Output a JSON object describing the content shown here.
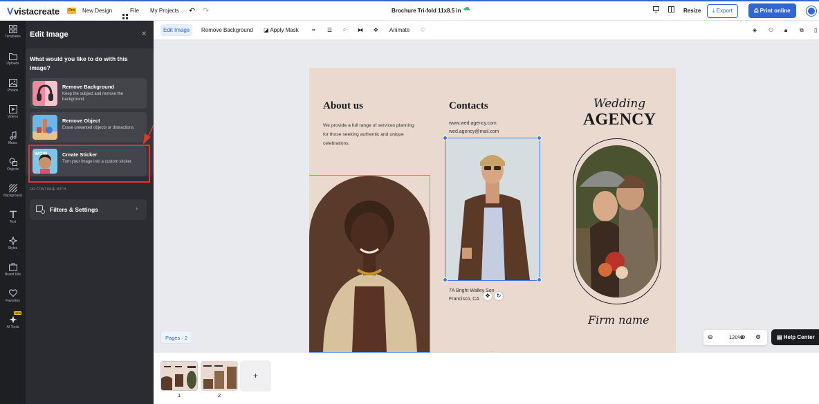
{
  "header": {
    "logo": "vistacreate",
    "pro_badge": "Pro",
    "new_design": "New Design",
    "file": "File",
    "my_projects": "My Projects",
    "doc_title": "Brochure Tri-fold 11x8.5 in",
    "resize": "Resize",
    "export": "Export",
    "print_online": "Print online"
  },
  "rail": {
    "items": [
      {
        "label": "Templates",
        "icon": "templates-icon"
      },
      {
        "label": "Uploads",
        "icon": "folder-icon"
      },
      {
        "label": "Photos",
        "icon": "image-icon"
      },
      {
        "label": "Videos",
        "icon": "video-icon"
      },
      {
        "label": "Music",
        "icon": "music-icon"
      },
      {
        "label": "Objects",
        "icon": "shapes-icon"
      },
      {
        "label": "Background",
        "icon": "pattern-icon"
      },
      {
        "label": "Text",
        "icon": "text-icon"
      },
      {
        "label": "Styles",
        "icon": "sparkle-icon"
      },
      {
        "label": "Brand Kits",
        "icon": "briefcase-icon"
      },
      {
        "label": "Favorites",
        "icon": "heart-icon"
      },
      {
        "label": "AI Tools",
        "icon": "ai-sparkle-icon"
      }
    ],
    "new_badge": "NEW"
  },
  "panel": {
    "title": "Edit Image",
    "question": "What would you like to do with this image?",
    "options": [
      {
        "title": "Remove Background",
        "desc": "Keep the subject and remove the background."
      },
      {
        "title": "Remove Object",
        "desc": "Erase unwanted objects or distractions."
      },
      {
        "title": "Create Sticker",
        "desc": "Turn your image into a custom sticker."
      }
    ],
    "or_label": "OR CONTINUE WITH",
    "filters_label": "Filters & Settings"
  },
  "toolbar": {
    "edit_image": "Edit Image",
    "remove_background": "Remove Background",
    "apply_mask": "Apply Mask",
    "animate": "Animate"
  },
  "page_content": {
    "about_heading": "About us",
    "about_text": "We provide a full range of services planning for those seeking authentic and unique celebrations.",
    "contacts_heading": "Contacts",
    "website": "www.wed.agency.com",
    "email": "wed.agency@mail.com",
    "address_line1": "7A Bright Walley Son",
    "address_line2": "Francisco, CA",
    "wedding_script": "Wedding",
    "agency": "AGENCY",
    "firm_name": "Firm name"
  },
  "status": {
    "pages_chip": "Pages · 2",
    "zoom": "120%",
    "help_center": "Help Center"
  },
  "pages": {
    "thumbs": [
      "1",
      "2"
    ],
    "add": "+"
  },
  "colors": {
    "accent": "#2f66d0",
    "highlight": "#e0362d",
    "page_bg": "#ead9cf"
  }
}
